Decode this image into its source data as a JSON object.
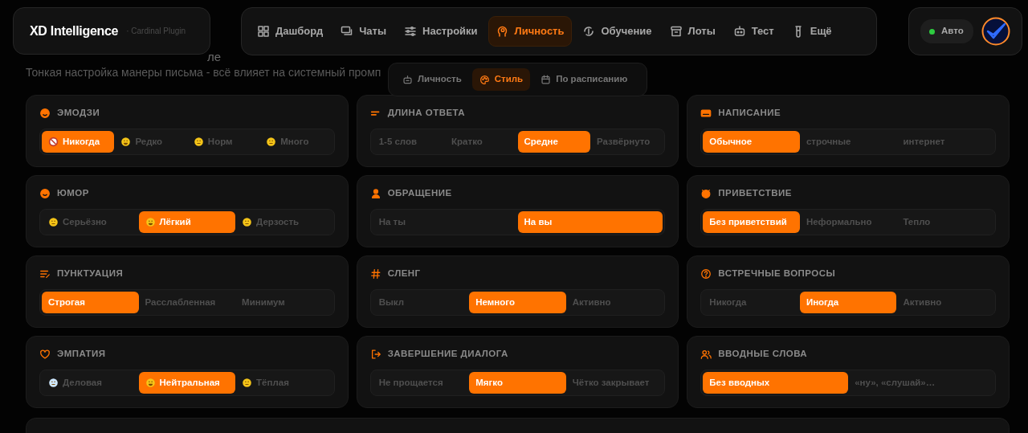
{
  "brand": {
    "name": "XD Intelligence",
    "tagline": "· Cardinal Plugin"
  },
  "nav": [
    {
      "label": "Дашборд",
      "selected": false
    },
    {
      "label": "Чаты",
      "selected": false
    },
    {
      "label": "Настройки",
      "selected": false
    },
    {
      "label": "Личность",
      "selected": true
    },
    {
      "label": "Обучение",
      "selected": false
    },
    {
      "label": "Лоты",
      "selected": false
    },
    {
      "label": "Тест",
      "selected": false
    },
    {
      "label": "Ещё",
      "selected": false
    }
  ],
  "status": {
    "label": "Авто",
    "on": true
  },
  "page": {
    "title_fragment": "ле",
    "subtitle": "Тонкая настройка манеры письма - всё влияет на системный промп"
  },
  "subnav": [
    {
      "label": "Личность",
      "selected": false
    },
    {
      "label": "Стиль",
      "selected": true
    },
    {
      "label": "По расписанию",
      "selected": false
    }
  ],
  "groups": [
    {
      "title": "ЭМОДЗИ",
      "kind": "emoji",
      "options": [
        {
          "label": "Никогда",
          "selected": true
        },
        {
          "label": "Редко",
          "selected": false
        },
        {
          "label": "Норм",
          "selected": false
        },
        {
          "label": "Много",
          "selected": false
        }
      ]
    },
    {
      "title": "ДЛИНА ОТВЕТА",
      "kind": "plain",
      "options": [
        {
          "label": "1-5 слов",
          "selected": false
        },
        {
          "label": "Кратко",
          "selected": false
        },
        {
          "label": "Средне",
          "selected": true
        },
        {
          "label": "Развёрнуто",
          "selected": false
        }
      ]
    },
    {
      "title": "НАПИСАНИЕ",
      "kind": "plain",
      "options": [
        {
          "label": "Обычное",
          "selected": true
        },
        {
          "label": "строчные",
          "selected": false
        },
        {
          "label": "интернет",
          "selected": false
        }
      ]
    },
    {
      "title": "ЮМОР",
      "kind": "emoji",
      "options": [
        {
          "label": "Серьёзно",
          "selected": false
        },
        {
          "label": "Лёгкий",
          "selected": true
        },
        {
          "label": "Дерзость",
          "selected": false
        }
      ]
    },
    {
      "title": "ОБРАЩЕНИЕ",
      "kind": "plain",
      "options": [
        {
          "label": "На ты",
          "selected": false
        },
        {
          "label": "На вы",
          "selected": true
        }
      ]
    },
    {
      "title": "ПРИВЕТСТВИЕ",
      "kind": "plain",
      "options": [
        {
          "label": "Без приветствий",
          "selected": true
        },
        {
          "label": "Неформально",
          "selected": false
        },
        {
          "label": "Тепло",
          "selected": false
        }
      ]
    },
    {
      "title": "ПУНКТУАЦИЯ",
      "kind": "plain",
      "options": [
        {
          "label": "Строгая",
          "selected": true
        },
        {
          "label": "Расслабленная",
          "selected": false
        },
        {
          "label": "Минимум",
          "selected": false
        }
      ]
    },
    {
      "title": "СЛЕНГ",
      "kind": "plain",
      "options": [
        {
          "label": "Выкл",
          "selected": false
        },
        {
          "label": "Немного",
          "selected": true
        },
        {
          "label": "Активно",
          "selected": false
        }
      ]
    },
    {
      "title": "ВСТРЕЧНЫЕ ВОПРОСЫ",
      "kind": "plain",
      "options": [
        {
          "label": "Никогда",
          "selected": false
        },
        {
          "label": "Иногда",
          "selected": true
        },
        {
          "label": "Активно",
          "selected": false
        }
      ]
    },
    {
      "title": "ЭМПАТИЯ",
      "kind": "emoji",
      "options": [
        {
          "label": "Деловая",
          "selected": false
        },
        {
          "label": "Нейтральная",
          "selected": true
        },
        {
          "label": "Тёплая",
          "selected": false
        }
      ]
    },
    {
      "title": "ЗАВЕРШЕНИЕ ДИАЛОГА",
      "kind": "plain",
      "options": [
        {
          "label": "Не прощается",
          "selected": false
        },
        {
          "label": "Мягко",
          "selected": true
        },
        {
          "label": "Чётко закрывает",
          "selected": false
        }
      ]
    },
    {
      "title": "ВВОДНЫЕ СЛОВА",
      "kind": "plain",
      "options": [
        {
          "label": "Без вводных",
          "selected": true
        },
        {
          "label": "«ну», «слушай»…",
          "selected": false
        }
      ]
    }
  ]
}
